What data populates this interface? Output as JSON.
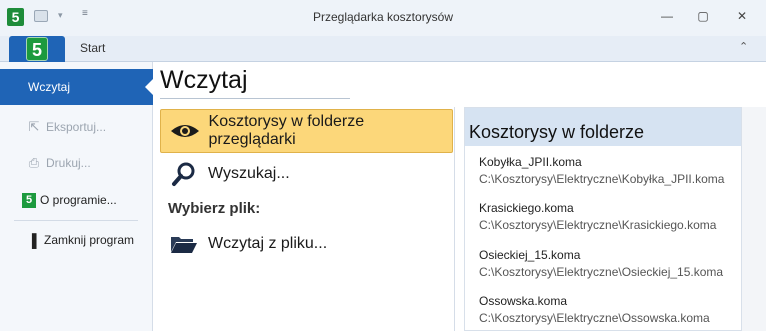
{
  "window": {
    "title": "Przeglądarka kosztorysów",
    "app_badge": "5",
    "minimize_glyph": "—",
    "maximize_glyph": "▢",
    "close_glyph": "✕"
  },
  "ribbon": {
    "file_tab_logo": "5",
    "tabs": [
      {
        "label": "Start"
      }
    ],
    "collapse_glyph": "⌃"
  },
  "backstage": {
    "items": [
      {
        "label": "Wczytaj",
        "icon": "none",
        "state": "active"
      },
      {
        "label": "Eksportuj...",
        "icon": "export-icon",
        "state": "disabled"
      },
      {
        "label": "Drukuj...",
        "icon": "printer-icon",
        "state": "disabled"
      },
      {
        "label": "O programie...",
        "icon": "app-logo-icon",
        "state": "normal"
      },
      {
        "label": "Zamknij program",
        "icon": "exit-door-icon",
        "state": "normal"
      }
    ]
  },
  "main": {
    "title": "Wczytaj",
    "actions": [
      {
        "label": "Kosztorysy w folderze przeglądarki",
        "icon": "eye-icon",
        "selected": true
      },
      {
        "label": "Wyszukaj...",
        "icon": "magnifier-icon",
        "selected": false
      }
    ],
    "section_label": "Wybierz plik:",
    "open_file": {
      "label": "Wczytaj z pliku...",
      "icon": "open-folder-icon"
    }
  },
  "folder_panel": {
    "title": "Kosztorysy w folderze",
    "files": [
      {
        "name": "Kobyłka_JPII.koma",
        "path": "C:\\Kosztorysy\\Elektryczne\\Kobyłka_JPII.koma"
      },
      {
        "name": "Krasickiego.koma",
        "path": "C:\\Kosztorysy\\Elektryczne\\Krasickiego.koma"
      },
      {
        "name": "Osieckiej_15.koma",
        "path": "C:\\Kosztorysy\\Elektryczne\\Osieckiej_15.koma"
      },
      {
        "name": "Ossowska.koma",
        "path": "C:\\Kosztorysy\\Elektryczne\\Ossowska.koma"
      }
    ]
  },
  "colors": {
    "accent": "#1f64b6",
    "selected_action": "#fcd77a",
    "panel_header": "#d6e3f2",
    "brand_green": "#1c9a3e"
  }
}
